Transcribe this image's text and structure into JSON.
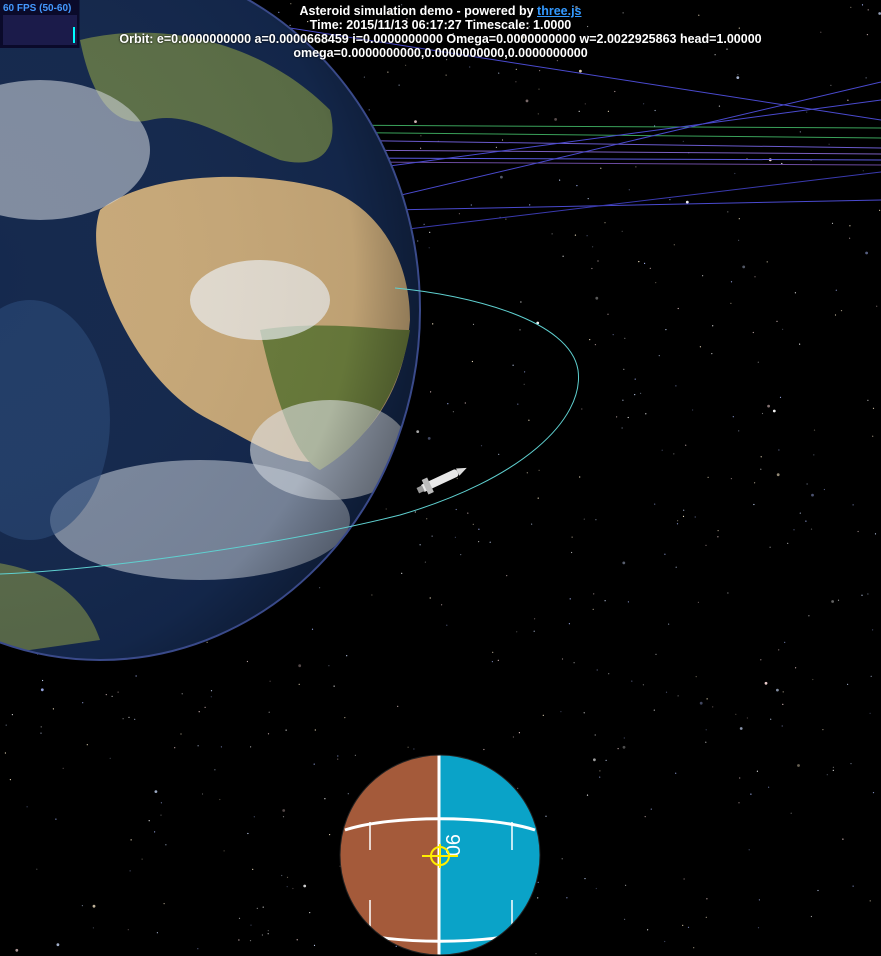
{
  "fps_meter": {
    "label": "60 FPS (50-60)",
    "fill": 0.55
  },
  "header": {
    "title_prefix": "Asteroid simulation demo - powered by ",
    "link_text": "three.js",
    "time_line": "Time: 2015/11/13 06:17:27 Timescale: 1.0000",
    "orbit_line": "Orbit: e=0.0000000000 a=0.0000668459 i=0.0000000000 Omega=0.0000000000 w=2.0022925863 head=1.00000",
    "omega_line": "omega=0.0000000000,0.0000000000,0.0000000000"
  },
  "navball": {
    "heading_label": "90",
    "colors": {
      "ground": "#a45a3a",
      "sky": "#0aa3c8",
      "marker": "#ffee00"
    }
  },
  "colors": {
    "orbit": "#5fd0d0",
    "asteroid_lines": "#5a5adf"
  }
}
